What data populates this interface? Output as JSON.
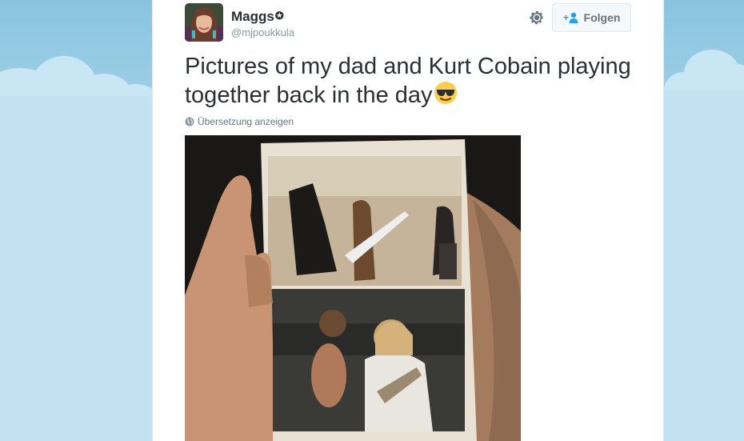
{
  "user": {
    "display_name": "Maggs",
    "badge": "✪",
    "handle": "@mjpoukkula"
  },
  "actions": {
    "follow_label": "Folgen"
  },
  "tweet": {
    "text": "Pictures of my dad and Kurt Cobain playing together back in the day",
    "emoji": "smiling-face-with-sunglasses"
  },
  "translation": {
    "label": "Übersetzung anzeigen"
  },
  "media": {
    "description_icon": "photo"
  },
  "colors": {
    "sky": "#a6d2e8",
    "card": "#ffffff",
    "text": "#292f33",
    "muted": "#8899a6",
    "link_blue": "#1da1f2"
  }
}
